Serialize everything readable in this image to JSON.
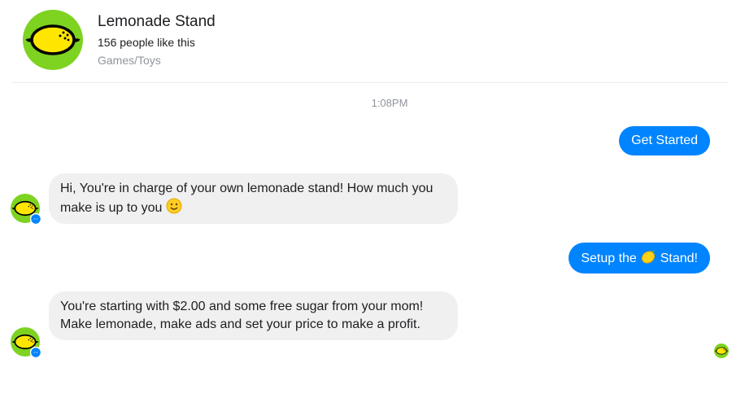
{
  "header": {
    "page_name": "Lemonade Stand",
    "likes": "156 people like this",
    "category": "Games/Toys",
    "avatar_icon": "lemon-icon"
  },
  "thread": {
    "timestamp": "1:08PM",
    "messages": [
      {
        "from": "user",
        "text": "Get Started"
      },
      {
        "from": "bot",
        "text": "Hi, You're in charge of your own lemonade stand! How much you make is up to you",
        "trailing_icon": "smiley-emoji-icon"
      },
      {
        "from": "user",
        "text_before": "Setup the",
        "icon": "lemon-emoji-icon",
        "text_after": "Stand!"
      },
      {
        "from": "bot",
        "text": "You're starting with $2.00 and some free sugar from your mom! Make lemonade, make ads and set your price to make a profit."
      }
    ]
  },
  "colors": {
    "brand_green": "#7ed321",
    "lemon_yellow": "#ffe600",
    "outgoing_bubble": "#0084ff",
    "incoming_bubble": "#f1f0f0",
    "muted_text": "#90949c"
  }
}
